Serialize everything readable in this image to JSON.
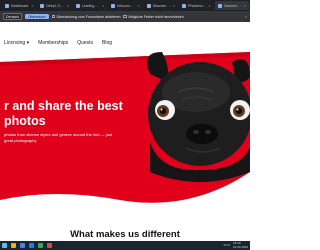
{
  "browser": {
    "tabs": [
      {
        "label": "Dashboard"
      },
      {
        "label": "Deepl, Übersetzer"
      },
      {
        "label": "Landing Page C..."
      },
      {
        "label": "fotocommunity..."
      },
      {
        "label": "Discover and s..."
      },
      {
        "label": "Photobucket | P..."
      },
      {
        "label": "Discover and s..."
      }
    ],
    "tab_close": "×"
  },
  "translate_bar": {
    "selected_language": "Deutsch",
    "translate_button": "Übersetzen",
    "checkbox_1": "Übersetzung vom Formularen aktivieren",
    "checkbox_2": "Mögliche Fehler nicht hervorheben",
    "close": "×"
  },
  "nav": {
    "items": [
      "Licensing",
      "Memberships",
      "Quests",
      "Blog"
    ],
    "chevron": "▾"
  },
  "hero": {
    "title": "r and share the best photos",
    "subtitle": "photos from diverse styles and genres around the hub — just great photography",
    "accent_color": "#e0001b"
  },
  "section": {
    "title": "What makes us different"
  },
  "taskbar": {
    "weather": "12°C",
    "time": "15:30",
    "date": "21.04.2023"
  }
}
